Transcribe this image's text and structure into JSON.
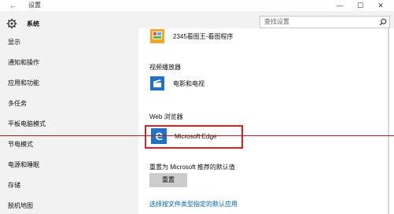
{
  "window": {
    "back_glyph": "←",
    "title": "设置",
    "min_glyph": "—",
    "max_glyph": "☐",
    "close_glyph": "✕"
  },
  "sidebar": {
    "header": "系统",
    "items": [
      {
        "label": "显示"
      },
      {
        "label": "通知和操作"
      },
      {
        "label": "应用和功能"
      },
      {
        "label": "多任务"
      },
      {
        "label": "平板电脑模式"
      },
      {
        "label": "节电模式"
      },
      {
        "label": "电源和睡眠"
      },
      {
        "label": "存储"
      },
      {
        "label": "脱机地图"
      }
    ]
  },
  "search": {
    "placeholder": "查找设置",
    "icon": "search-icon"
  },
  "main": {
    "top_app": {
      "label": "2345看图王-看图程序",
      "icon": "image-viewer-icon"
    },
    "video_section": "视频播放器",
    "video_app": {
      "label": "电影和电视",
      "icon": "movies-tv-icon"
    },
    "web_section": "Web 浏览器",
    "web_app": {
      "label": "Microsoft Edge",
      "icon": "edge-icon"
    },
    "reset_section": "重置为 Microsoft 推荐的默认值",
    "reset_button": "重置",
    "file_type_link": "选择按文件类型指定的默认应用"
  },
  "colors": {
    "accent": "#0063b1",
    "highlight": "#e01f1f",
    "edge_tile": "#1e73c8"
  }
}
